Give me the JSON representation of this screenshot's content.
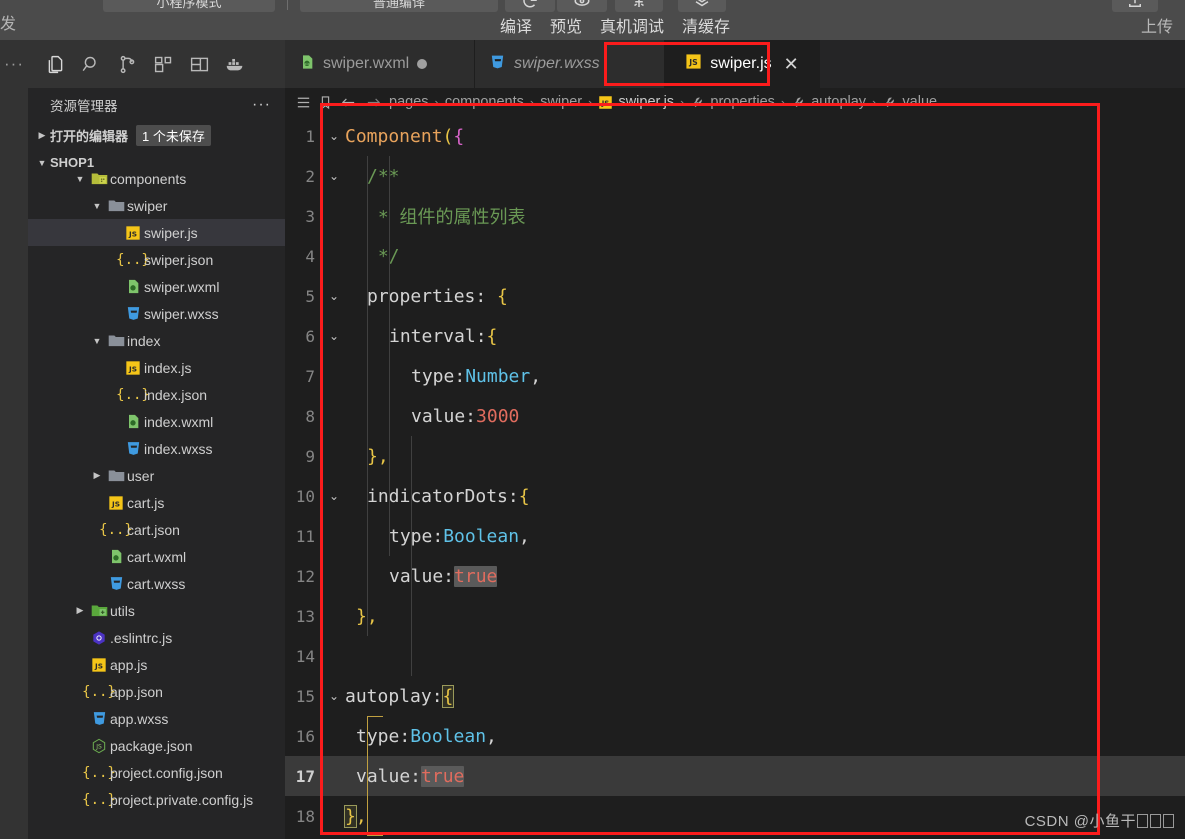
{
  "devtools": {
    "mode_label": "小程序模式",
    "compile_label": "普通编译",
    "left_label": "发",
    "menu": [
      "编译",
      "预览",
      "真机调试",
      "清缓存"
    ],
    "upload_label": "上传"
  },
  "activity_bar": {
    "overflow_label": "···",
    "icons": [
      "files-icon",
      "search-icon",
      "source-control-icon",
      "extensions-icon",
      "layout-icon",
      "docker-icon"
    ]
  },
  "explorer": {
    "title": "资源管理器",
    "more_label": "···",
    "open_editors": {
      "label": "打开的编辑器",
      "badge": "1 个未保存"
    },
    "project": "SHOP1",
    "tree": [
      {
        "name": "components",
        "icon": "folder-open-git",
        "depth": 2,
        "caret": "down",
        "type": "folder",
        "selected": false
      },
      {
        "name": "swiper",
        "icon": "folder-open",
        "depth": 3,
        "caret": "down",
        "type": "folder",
        "selected": false
      },
      {
        "name": "swiper.js",
        "icon": "js",
        "depth": 4,
        "caret": "none",
        "type": "file",
        "selected": true
      },
      {
        "name": "swiper.json",
        "icon": "json",
        "depth": 4,
        "caret": "none",
        "type": "file",
        "selected": false
      },
      {
        "name": "swiper.wxml",
        "icon": "wxml",
        "depth": 4,
        "caret": "none",
        "type": "file",
        "selected": false
      },
      {
        "name": "swiper.wxss",
        "icon": "wxss",
        "depth": 4,
        "caret": "none",
        "type": "file",
        "selected": false
      },
      {
        "name": "index",
        "icon": "folder-open",
        "depth": 3,
        "caret": "down",
        "type": "folder",
        "selected": false
      },
      {
        "name": "index.js",
        "icon": "js",
        "depth": 4,
        "caret": "none",
        "type": "file",
        "selected": false
      },
      {
        "name": "index.json",
        "icon": "json",
        "depth": 4,
        "caret": "none",
        "type": "file",
        "selected": false
      },
      {
        "name": "index.wxml",
        "icon": "wxml",
        "depth": 4,
        "caret": "none",
        "type": "file",
        "selected": false
      },
      {
        "name": "index.wxss",
        "icon": "wxss",
        "depth": 4,
        "caret": "none",
        "type": "file",
        "selected": false
      },
      {
        "name": "user",
        "icon": "folder-closed",
        "depth": 3,
        "caret": "right",
        "type": "folder",
        "selected": false
      },
      {
        "name": "cart.js",
        "icon": "js",
        "depth": 3,
        "caret": "none",
        "type": "file",
        "selected": false
      },
      {
        "name": "cart.json",
        "icon": "json",
        "depth": 3,
        "caret": "none",
        "type": "file",
        "selected": false
      },
      {
        "name": "cart.wxml",
        "icon": "wxml",
        "depth": 3,
        "caret": "none",
        "type": "file",
        "selected": false
      },
      {
        "name": "cart.wxss",
        "icon": "wxss",
        "depth": 3,
        "caret": "none",
        "type": "file",
        "selected": false
      },
      {
        "name": "utils",
        "icon": "folder-green",
        "depth": 2,
        "caret": "right",
        "type": "folder",
        "selected": false
      },
      {
        "name": ".eslintrc.js",
        "icon": "eslint",
        "depth": 2,
        "caret": "none",
        "type": "file",
        "selected": false
      },
      {
        "name": "app.js",
        "icon": "js",
        "depth": 2,
        "caret": "none",
        "type": "file",
        "selected": false
      },
      {
        "name": "app.json",
        "icon": "json",
        "depth": 2,
        "caret": "none",
        "type": "file",
        "selected": false
      },
      {
        "name": "app.wxss",
        "icon": "wxss",
        "depth": 2,
        "caret": "none",
        "type": "file",
        "selected": false
      },
      {
        "name": "package.json",
        "icon": "npm",
        "depth": 2,
        "caret": "none",
        "type": "file",
        "selected": false
      },
      {
        "name": "project.config.json",
        "icon": "json",
        "depth": 2,
        "caret": "none",
        "type": "file",
        "selected": false
      },
      {
        "name": "project.private.config.js",
        "icon": "json",
        "depth": 2,
        "caret": "none",
        "type": "file",
        "selected": false
      }
    ]
  },
  "editor": {
    "tabs": [
      {
        "label": "swiper.wxml",
        "icon": "wxml",
        "active": false,
        "dirty": true,
        "closable": false
      },
      {
        "label": "swiper.wxss",
        "icon": "wxss",
        "active": false,
        "dirty": false,
        "closable": false
      },
      {
        "label": "swiper.js",
        "icon": "js",
        "active": true,
        "dirty": false,
        "closable": true
      }
    ],
    "close_glyph": "✕",
    "breadcrumb": [
      "pages",
      "components",
      "swiper",
      "swiper.js",
      "properties",
      "autoplay",
      "value"
    ],
    "breadcrumb_separator": "›",
    "code_lines": [
      {
        "n": 1,
        "fold": "down",
        "highlight": false
      },
      {
        "n": 2,
        "fold": "down",
        "highlight": false
      },
      {
        "n": 3,
        "fold": "none",
        "highlight": false
      },
      {
        "n": 4,
        "fold": "none",
        "highlight": false
      },
      {
        "n": 5,
        "fold": "down",
        "highlight": false
      },
      {
        "n": 6,
        "fold": "down",
        "highlight": false
      },
      {
        "n": 7,
        "fold": "none",
        "highlight": false
      },
      {
        "n": 8,
        "fold": "none",
        "highlight": false
      },
      {
        "n": 9,
        "fold": "none",
        "highlight": false
      },
      {
        "n": 10,
        "fold": "down",
        "highlight": false
      },
      {
        "n": 11,
        "fold": "none",
        "highlight": false
      },
      {
        "n": 12,
        "fold": "none",
        "highlight": false
      },
      {
        "n": 13,
        "fold": "none",
        "highlight": false
      },
      {
        "n": 14,
        "fold": "none",
        "highlight": false
      },
      {
        "n": 15,
        "fold": "down",
        "highlight": false
      },
      {
        "n": 16,
        "fold": "none",
        "highlight": false
      },
      {
        "n": 17,
        "fold": "none",
        "highlight": true
      },
      {
        "n": 18,
        "fold": "none",
        "highlight": false
      }
    ],
    "code_text": {
      "l1": "Component({",
      "l2": "/**",
      "l3": "* 组件的属性列表",
      "l4": "*/",
      "l5": "properties: {",
      "l6": "interval:{",
      "l7": "type:Number,",
      "l8": "value:3000",
      "l9": "},",
      "l10": "indicatorDots:{",
      "l11": "type:Boolean,",
      "l12": "value:true",
      "l13": "},",
      "l14": "",
      "l15": "autoplay:{",
      "l16": "type:Boolean,",
      "l17": "value:true",
      "l18": "},"
    }
  },
  "annotations": {
    "watermark_prefix": "CSDN @小鱼干",
    "highlight_color": "#fb1c1c"
  }
}
